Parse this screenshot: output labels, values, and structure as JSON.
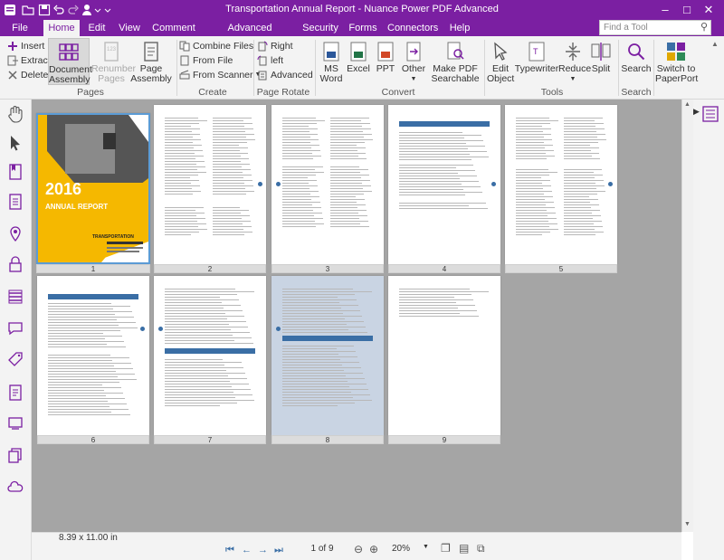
{
  "window": {
    "title": "Transportation Annual Report - Nuance Power PDF Advanced",
    "accent": "#7b1fa2"
  },
  "menu": {
    "tabs": [
      "File",
      "Home",
      "Edit",
      "View",
      "Comment",
      "Advanced Processing",
      "Security",
      "Forms",
      "Connectors",
      "Help"
    ],
    "active": "Home",
    "find_placeholder": "Find a Tool"
  },
  "ribbon": {
    "pages": {
      "insert": "Insert",
      "extract": "Extract",
      "delete": "Delete",
      "document_assembly": [
        "Document",
        "Assembly"
      ],
      "renumber_pages": [
        "Renumber",
        "Pages"
      ],
      "page_assembly": [
        "Page",
        "Assembly"
      ],
      "group": "Pages"
    },
    "create": {
      "combine_files": "Combine Files",
      "from_file": "From File",
      "from_scanner": "From Scanner",
      "group": "Create"
    },
    "page_rotate": {
      "right": "Right",
      "left": "left",
      "advanced": "Advanced",
      "group": "Page Rotate"
    },
    "convert": {
      "ms_word": [
        "MS",
        "Word"
      ],
      "excel": "Excel",
      "ppt": "PPT",
      "other": "Other",
      "make_searchable": [
        "Make PDF",
        "Searchable"
      ],
      "group": "Convert"
    },
    "tools": {
      "edit_object": [
        "Edit",
        "Object"
      ],
      "typewriter": "Typewriter",
      "reduce": "Reduce",
      "split": "Split",
      "group": "Tools"
    },
    "search": {
      "search": "Search",
      "group": "Search"
    },
    "switch": {
      "label": [
        "Switch to",
        "PaperPort"
      ]
    }
  },
  "thumbnails": {
    "pages": [
      "1",
      "2",
      "3",
      "4",
      "5",
      "6",
      "7",
      "8",
      "9"
    ],
    "cover": {
      "year": "2016",
      "title": "ANNUAL REPORT",
      "brand": "TRANSPORTATION"
    }
  },
  "statusbar": {
    "page_size": "8.39 x 11.00 in",
    "page_indicator": "1 of 9",
    "zoom": "20%"
  }
}
